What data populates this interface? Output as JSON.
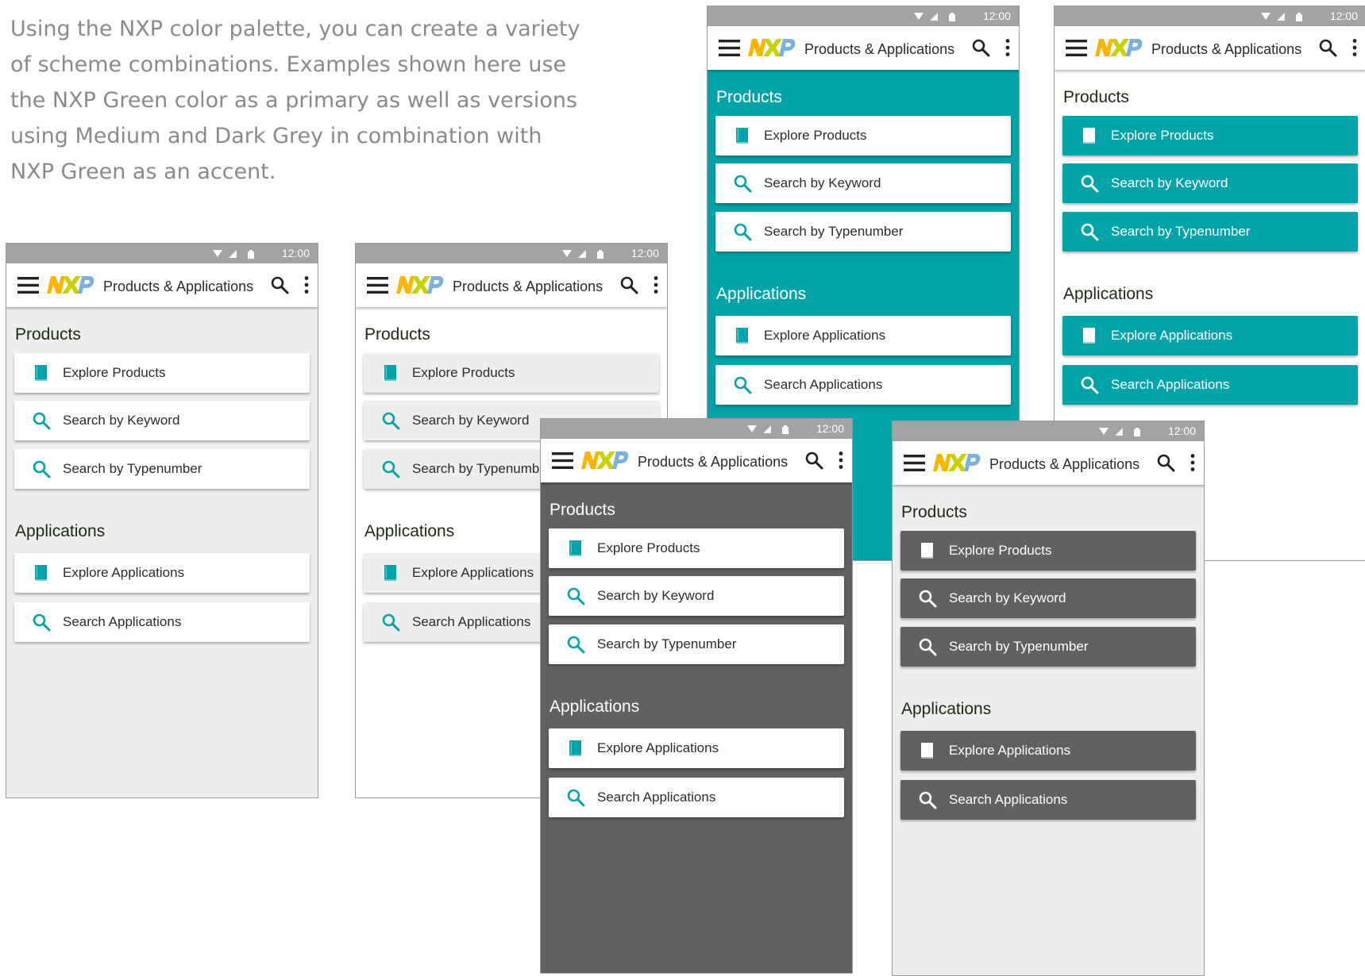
{
  "intro_text": "Using the NXP color palette, you can create a variety of scheme combinations.  Examples shown here use the NXP Green color as a primary as well as versions using Medium and Dark Grey in combination with NXP Green as an accent.",
  "status_time": "12:00",
  "app_title": "Products & Applications",
  "products_heading": "Products",
  "applications_heading": "Applications",
  "buttons": {
    "explore_products": "Explore Products",
    "search_keyword": "Search by Keyword",
    "search_typenumber": "Search by Typenumber",
    "explore_applications": "Explore Applications",
    "search_applications": "Search Applications"
  },
  "colors": {
    "nxp_green": "#00a3a8",
    "medium_grey": "#eeeeee",
    "dark_grey": "#616161",
    "statusbar_grey": "#a3a3a3",
    "logo_yellow": "#f9b500",
    "logo_lime": "#c9d200",
    "logo_blue": "#7bb1db"
  },
  "icons": [
    "menu-icon",
    "nxp-logo",
    "search-icon",
    "more-vert-icon",
    "book-icon",
    "wifi-icon",
    "signal-icon",
    "battery-icon"
  ]
}
